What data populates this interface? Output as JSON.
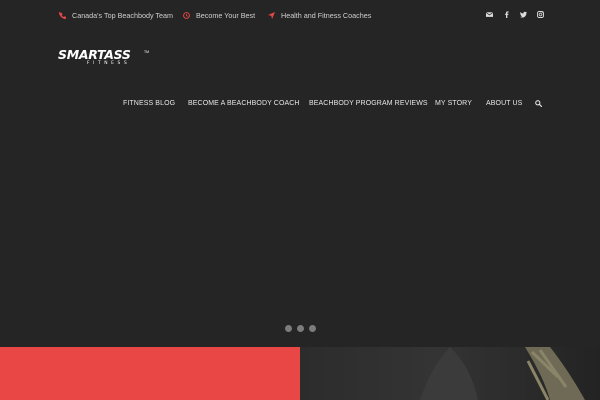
{
  "topbar": {
    "items": [
      {
        "icon": "phone-icon",
        "label": "Canada's Top Beachbody Team"
      },
      {
        "icon": "clock-icon",
        "label": "Become Your Best"
      },
      {
        "icon": "location-arrow-icon",
        "label": "Health and Fitness Coaches"
      }
    ],
    "social": [
      "envelope-icon",
      "facebook-icon",
      "twitter-icon",
      "instagram-icon"
    ],
    "accent": "#e94646"
  },
  "logo": {
    "wordmark": "SMARTASS",
    "tagline": "FITNESS",
    "tm": "TM"
  },
  "nav": {
    "items": [
      {
        "label": "FITNESS BLOG"
      },
      {
        "label": "BECOME A BEACHBODY COACH"
      },
      {
        "label": "BEACHBODY PROGRAM REVIEWS"
      },
      {
        "label": "MY STORY"
      },
      {
        "label": "ABOUT US"
      }
    ],
    "search_icon": "search-icon"
  },
  "slider": {
    "dot_count": 3,
    "background": "#252525"
  },
  "promo": {
    "left_color": "#e94646",
    "right_color": "#2a2a2a"
  }
}
